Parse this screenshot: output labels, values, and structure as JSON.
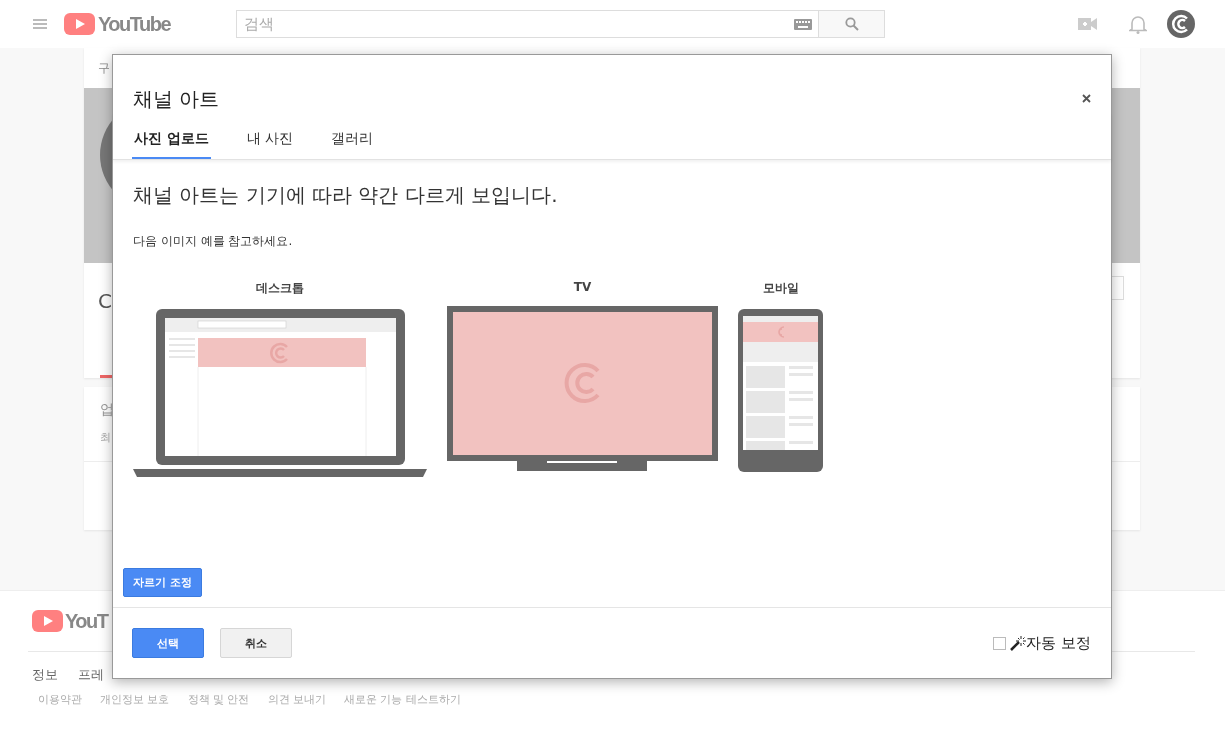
{
  "header": {
    "logo": "YouTube",
    "search": {
      "placeholder": "검색"
    }
  },
  "background": {
    "footer_logo": "YouT",
    "top_label": "구",
    "channel_initial": "C",
    "section_title": "업",
    "section_text": "최",
    "footer_nav": [
      "정보",
      "프레"
    ],
    "footer_links": [
      "이용약관",
      "개인정보 보호",
      "정책 및 안전",
      "의견 보내기",
      "새로운 기능 테스트하기"
    ]
  },
  "dialog": {
    "title": "채널 아트",
    "tabs": [
      {
        "label": "사진 업로드",
        "selected": true
      },
      {
        "label": "내 사진",
        "selected": false
      },
      {
        "label": "갤러리",
        "selected": false
      }
    ],
    "heading": "채널 아트는 기기에 따라 약간 다르게 보입니다.",
    "subtext": "다음 이미지 예를 참고하세요.",
    "devices": [
      {
        "kind": "desktop",
        "label": "데스크톱"
      },
      {
        "kind": "tv",
        "label": "TV"
      },
      {
        "kind": "mobile",
        "label": "모바일"
      }
    ],
    "crop_button": "자르기 조정",
    "select_button": "선택",
    "cancel_button": "취소",
    "auto_enhance": {
      "label": "자동 보정",
      "checked": false
    }
  }
}
